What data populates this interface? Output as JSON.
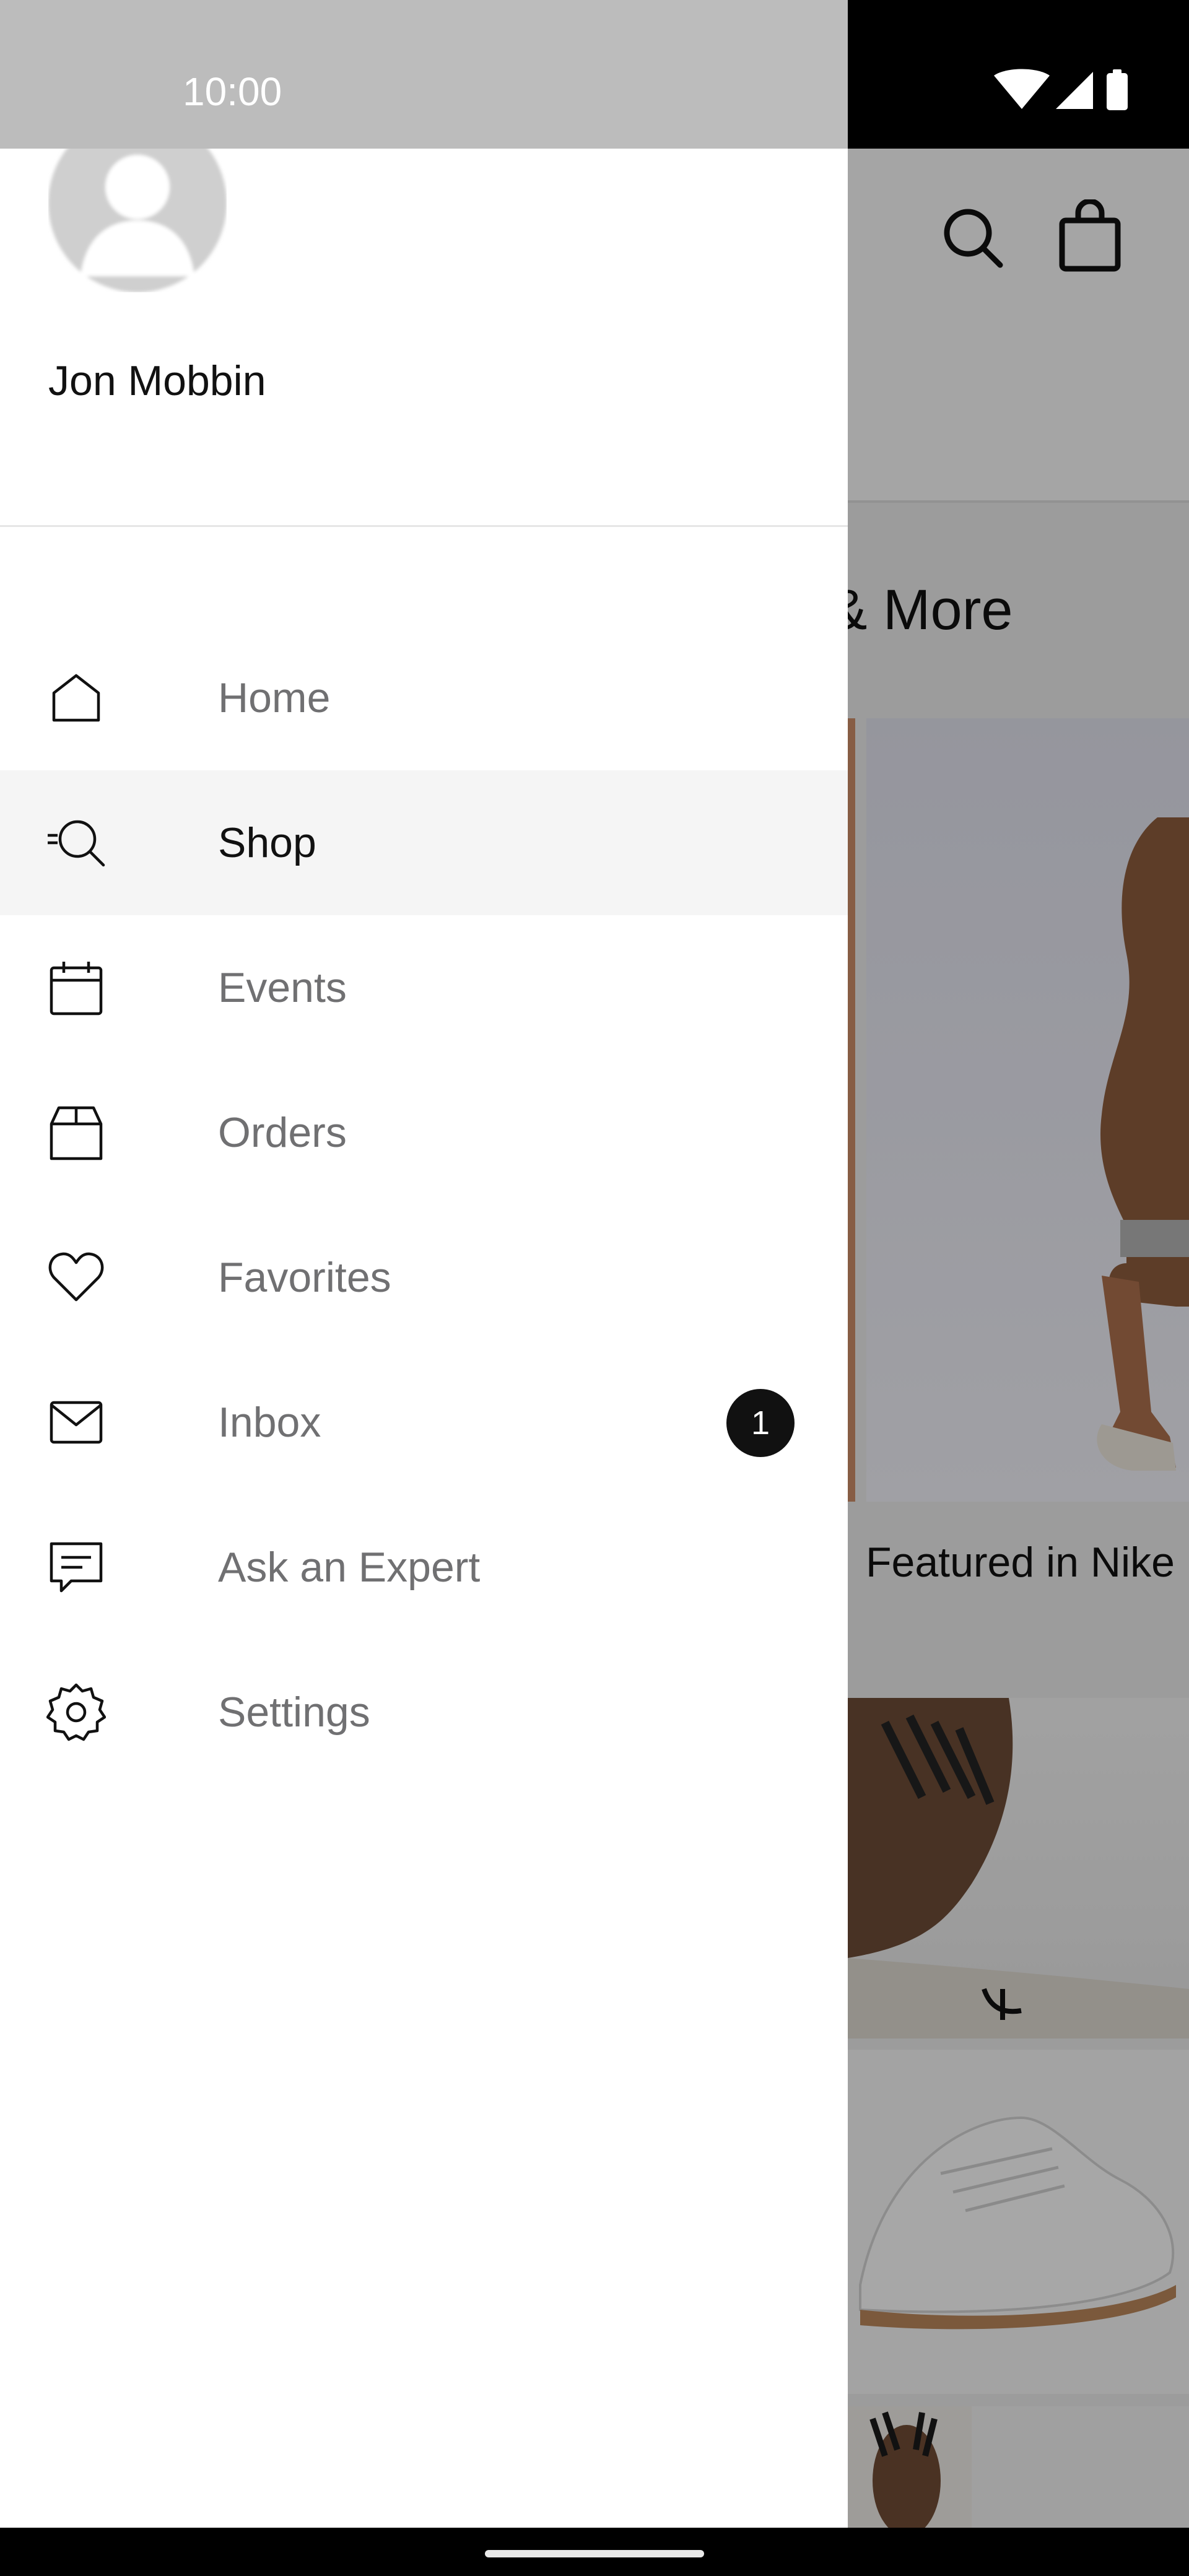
{
  "status_bar": {
    "time": "10:00",
    "icons": [
      "wifi-icon",
      "cellular-signal-icon",
      "battery-icon"
    ]
  },
  "profile": {
    "name": "Jon Mobbin",
    "avatar": "default-avatar"
  },
  "nav": {
    "items": [
      {
        "label": "Home",
        "icon": "home-icon",
        "active": false
      },
      {
        "label": "Shop",
        "icon": "shop-search-icon",
        "active": true
      },
      {
        "label": "Events",
        "icon": "calendar-icon",
        "active": false
      },
      {
        "label": "Orders",
        "icon": "box-icon",
        "active": false
      },
      {
        "label": "Favorites",
        "icon": "heart-icon",
        "active": false
      },
      {
        "label": "Inbox",
        "icon": "mail-icon",
        "active": false,
        "badge": "1"
      },
      {
        "label": "Ask an Expert",
        "icon": "chat-icon",
        "active": false
      },
      {
        "label": "Settings",
        "icon": "gear-icon",
        "active": false
      }
    ]
  },
  "background": {
    "title_partial": "& More",
    "caption_partial": "Featured in Nike",
    "icons": [
      "search-icon",
      "shopping-bag-icon"
    ]
  },
  "colors": {
    "drawer_bg": "#ffffff",
    "active_item_bg": "#f5f5f5",
    "label_inactive": "#707072",
    "label_active": "#111111",
    "badge_bg": "#111111"
  }
}
